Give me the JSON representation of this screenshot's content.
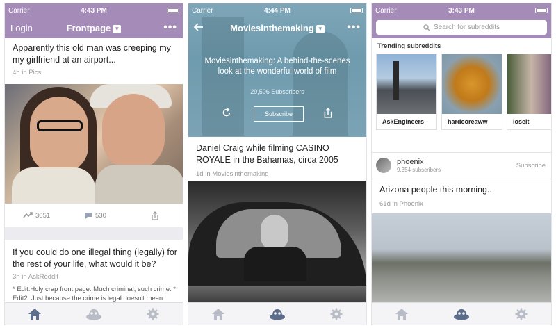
{
  "screens": [
    {
      "status": {
        "carrier": "Carrier",
        "time": "4:43 PM"
      },
      "nav": {
        "left": "Login",
        "title": "Frontpage",
        "more": "•••"
      },
      "posts": [
        {
          "title": "Apparently this old man was creeping my my girlfriend at an airport...",
          "age": "4h",
          "in": "in",
          "subreddit": "Pics",
          "upvotes": "3051",
          "comments": "530"
        },
        {
          "title": "If you could do one illegal thing (legally) for the rest of your life, what would it be?",
          "age": "3h",
          "in": "in",
          "subreddit": "AskReddit",
          "body": "* Edit:Holy crap front page. Much criminal, such crime. * Edit2: Just because the crime is legal doesn't mean"
        }
      ]
    },
    {
      "status": {
        "carrier": "Carrier",
        "time": "4:44 PM"
      },
      "nav": {
        "title": "Moviesinthemaking",
        "more": "•••"
      },
      "hero": {
        "description": "Moviesinthemaking: A behind-the-scenes look at the wonderful world of film",
        "subscribers": "29,506 Subscribers",
        "subscribe_label": "Subscribe"
      },
      "post": {
        "title": "Daniel Craig while filming CASINO ROYALE in the Bahamas, circa 2005",
        "age": "1d",
        "in": "in",
        "subreddit": "Moviesinthemaking"
      }
    },
    {
      "status": {
        "carrier": "Carrier",
        "time": "3:43 PM"
      },
      "search": {
        "placeholder": "Search for subreddits"
      },
      "trending_label": "Trending subreddits",
      "trending": [
        {
          "name": "AskEngineers"
        },
        {
          "name": "hardcoreaww"
        },
        {
          "name": "loseit"
        }
      ],
      "featured": {
        "name": "phoenix",
        "subscribers": "9,354 subscribers",
        "subscribe_label": "Subscribe"
      },
      "post": {
        "title": "Arizona people this morning...",
        "age": "61d",
        "in": "in",
        "subreddit": "Phoenix"
      }
    }
  ],
  "tabs": [
    {
      "icon": "home-icon"
    },
    {
      "icon": "alien-icon"
    },
    {
      "icon": "gear-icon"
    }
  ],
  "colors": {
    "accent": "#a58bb8",
    "tab_active": "#5b6d8a",
    "tab_inactive": "#b8bcc6"
  }
}
